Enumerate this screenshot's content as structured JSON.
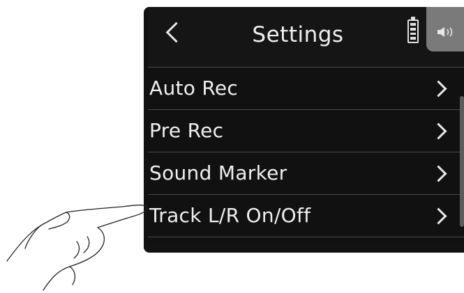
{
  "header": {
    "title": "Settings"
  },
  "menu": {
    "items": [
      {
        "label": "Auto Rec",
        "chevron": ">"
      },
      {
        "label": "Pre Rec",
        "chevron": ">"
      },
      {
        "label": "Sound Marker",
        "chevron": ">"
      },
      {
        "label": "Track L/R On/Off",
        "chevron": ">"
      }
    ]
  },
  "icons": {
    "back": "back-chevron-icon",
    "battery": "battery-icon",
    "speaker": "speaker-icon",
    "hand": "pointing-hand-icon"
  },
  "colors": {
    "screen_bg": "#111111",
    "text": "#f0f0f0",
    "divider": "#4a4a4a",
    "speaker_tab": "#7a7a7a"
  }
}
